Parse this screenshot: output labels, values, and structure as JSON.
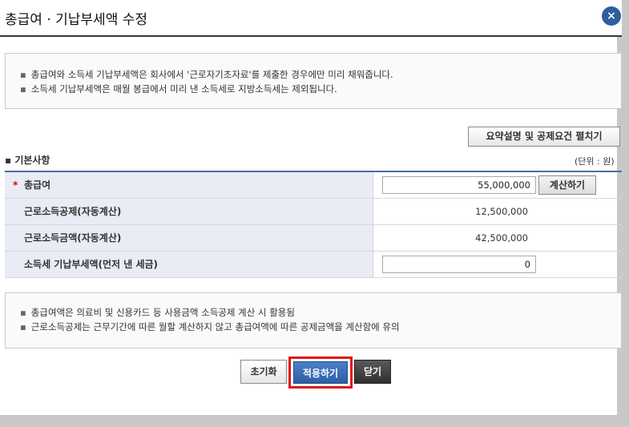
{
  "window": {
    "title": "총급여 · 기납부세액 수정",
    "close_glyph": "×"
  },
  "notice_top": {
    "lines": [
      "총급여와 소득세 기납부세액은 회사에서 '근로자기초자료'를 제출한 경우에만 미리 채워줍니다.",
      "소득세 기납부세액은 매월 봉급에서 미리 낸 소득세로 지방소득세는 제외됩니다."
    ]
  },
  "expand_button": "요약설명 및 공제요건 펼치기",
  "section": {
    "title": "기본사항",
    "unit": "(단위 : 원)"
  },
  "rows": [
    {
      "label": "총급여",
      "required": "*",
      "value": "55,000,000",
      "button": "계산하기"
    },
    {
      "label": "근로소득공제(자동계산)",
      "value": "12,500,000"
    },
    {
      "label": "근로소득금액(자동계산)",
      "value": "42,500,000"
    },
    {
      "label": "소득세 기납부세액(먼저 낸 세금)",
      "value": "0"
    }
  ],
  "notice_bottom": {
    "lines": [
      "총급여액은 의료비 및 신용카드 등 사용금액 소득공제 계산 시 활용됨",
      "근로소득공제는 근무기간에 따른 월할 계산하지 않고 총급여액에 따른 공제금액을 계산함에 유의"
    ]
  },
  "buttons": {
    "reset": "초기화",
    "apply": "적용하기",
    "close": "닫기"
  },
  "colors": {
    "accent": "#2f5f9c",
    "highlight": "#e01414",
    "label_bg": "#eaecf5"
  }
}
